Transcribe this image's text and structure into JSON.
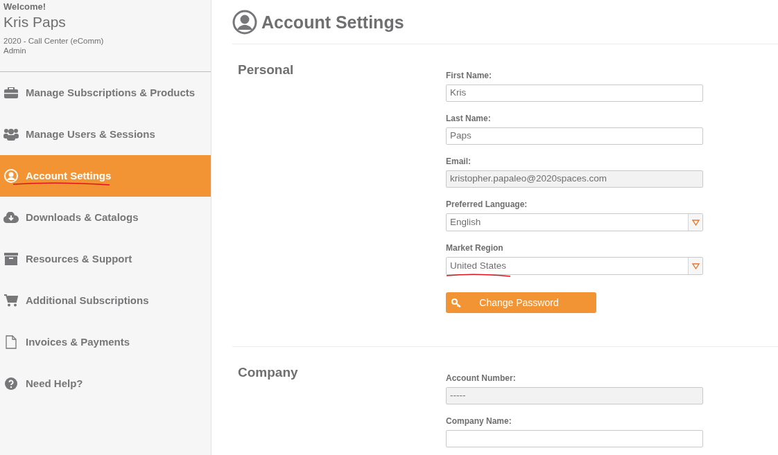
{
  "sidebar": {
    "welcome": "Welcome!",
    "user_name": "Kris Paps",
    "organization": "2020 - Call Center (eComm)",
    "role": "Admin",
    "items": [
      {
        "label": "Manage Subscriptions & Products",
        "selected": false,
        "annotated": false
      },
      {
        "label": "Manage Users & Sessions",
        "selected": false,
        "annotated": false
      },
      {
        "label": "Account Settings",
        "selected": true,
        "annotated": true
      },
      {
        "label": "Downloads & Catalogs",
        "selected": false,
        "annotated": false
      },
      {
        "label": "Resources & Support",
        "selected": false,
        "annotated": false
      },
      {
        "label": "Additional Subscriptions",
        "selected": false,
        "annotated": false
      },
      {
        "label": "Invoices & Payments",
        "selected": false,
        "annotated": false
      },
      {
        "label": "Need Help?",
        "selected": false,
        "annotated": false
      }
    ]
  },
  "page_title": "Account Settings",
  "sections": [
    {
      "title": "Personal",
      "fields": [
        {
          "kind": "text",
          "label": "First Name:",
          "value": "Kris",
          "disabled": false,
          "annotated": false
        },
        {
          "kind": "text",
          "label": "Last Name:",
          "value": "Paps",
          "disabled": false,
          "annotated": false
        },
        {
          "kind": "text",
          "label": "Email:",
          "value": "kristopher.papaleo@2020spaces.com",
          "disabled": true,
          "annotated": false
        },
        {
          "kind": "select",
          "label": "Preferred Language:",
          "value": "English",
          "disabled": false,
          "annotated": false
        },
        {
          "kind": "select",
          "label": "Market Region",
          "value": "United States",
          "disabled": false,
          "annotated": true
        }
      ],
      "button": {
        "label": "Change Password"
      }
    },
    {
      "title": "Company",
      "fields": [
        {
          "kind": "text",
          "label": "Account Number:",
          "value": "-----",
          "disabled": true,
          "annotated": false
        },
        {
          "kind": "text",
          "label": "Company Name:",
          "disabled": false,
          "annotated": false
        }
      ]
    }
  ]
}
